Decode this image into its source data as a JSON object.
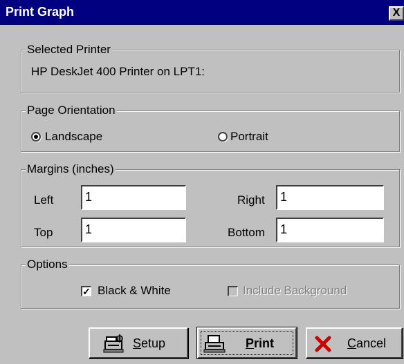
{
  "window": {
    "title": "Print Graph",
    "close_glyph": "X"
  },
  "selected_printer": {
    "legend": "Selected Printer",
    "value": "HP DeskJet 400 Printer on LPT1:"
  },
  "orientation": {
    "legend": "Page Orientation",
    "options": [
      {
        "label": "Landscape",
        "selected": true
      },
      {
        "label": "Portrait",
        "selected": false
      }
    ]
  },
  "margins": {
    "legend": "Margins (inches)",
    "left_label": "Left",
    "left_value": "1",
    "right_label": "Right",
    "right_value": "1",
    "top_label": "Top",
    "top_value": "1",
    "bottom_label": "Bottom",
    "bottom_value": "1"
  },
  "options": {
    "legend": "Options",
    "black_white_label": "Black & White",
    "black_white_checked": true,
    "include_background_label": "Include Background",
    "include_background_checked": false,
    "include_background_enabled": false
  },
  "buttons": {
    "setup_prefix": "",
    "setup_mnemonic": "S",
    "setup_rest": "etup",
    "print_mnemonic": "P",
    "print_rest": "rint",
    "cancel_mnemonic": "C",
    "cancel_rest": "ancel"
  },
  "icons": {
    "close": "close-icon",
    "setup": "printer-setup-icon",
    "print": "printer-icon",
    "cancel": "red-x-icon"
  },
  "colors": {
    "titlebar": "#000080",
    "face": "#c0c0c0",
    "cancel_x": "#cc0000"
  }
}
